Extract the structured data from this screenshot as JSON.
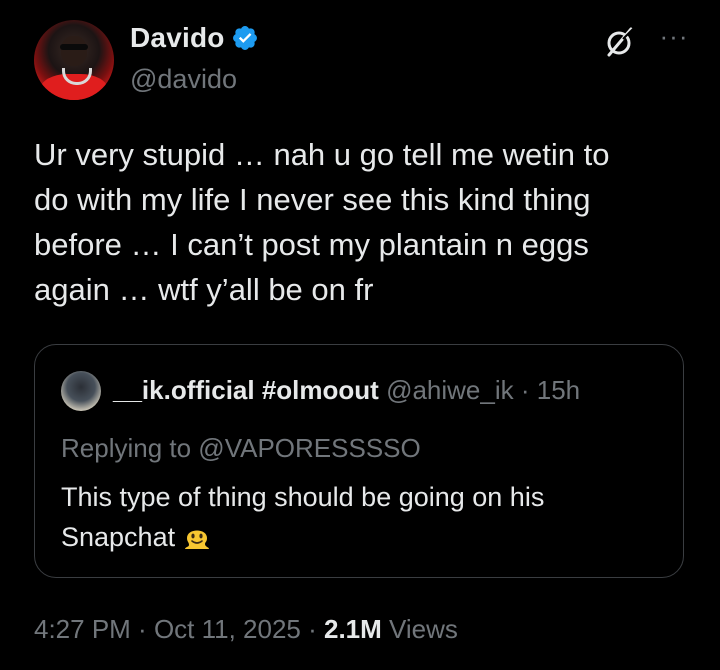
{
  "author": {
    "display_name": "Davido",
    "handle": "@davido",
    "verified": true,
    "verified_color": "#1d9bf0"
  },
  "header_icons": {
    "grok": "grok-icon",
    "more": "more-icon",
    "more_glyph": "···"
  },
  "tweet": {
    "text": "Ur very stupid … nah u go tell me wetin to\ndo with my life I never see this kind thing\nbefore … I can’t post my plantain n eggs\nagain … wtf y’all be on fr"
  },
  "quoted_tweet": {
    "display_name": "__ik.official #olmoout",
    "handle": "@ahiwe_ik",
    "separator": " · ",
    "time": "15h",
    "replying_to": "Replying to @VAPORESSSSO",
    "text": "This type of thing should be going on his Snapchat",
    "emoji": "melting-face-emoji"
  },
  "meta": {
    "time": "4:27 PM",
    "separator": " · ",
    "date": "Oct 11, 2025",
    "views_count": "2.1M",
    "views_label": " Views"
  },
  "colors": {
    "background": "#000000",
    "text_primary": "#e7e9ea",
    "text_secondary": "#71767b",
    "border": "#3a3d41"
  }
}
